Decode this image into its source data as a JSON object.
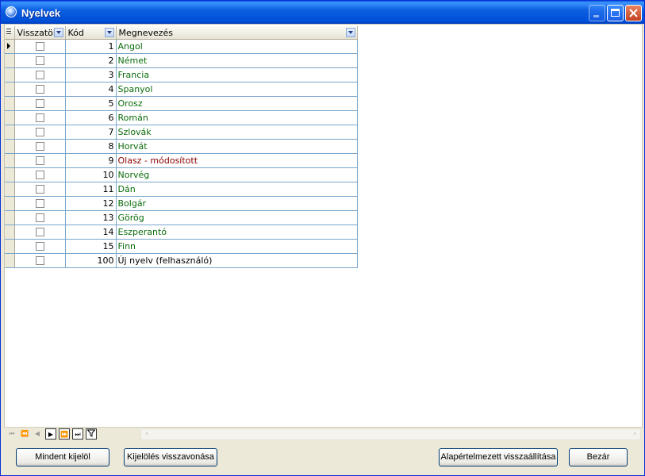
{
  "window": {
    "title": "Nyelvek"
  },
  "grid": {
    "columns": [
      {
        "label": "Visszatöl"
      },
      {
        "label": "Kód"
      },
      {
        "label": "Megnevezés"
      }
    ],
    "rows": [
      {
        "code": "1",
        "name": "Angol",
        "style": "normal"
      },
      {
        "code": "2",
        "name": "Német",
        "style": "normal"
      },
      {
        "code": "3",
        "name": "Francia",
        "style": "normal"
      },
      {
        "code": "4",
        "name": "Spanyol",
        "style": "normal"
      },
      {
        "code": "5",
        "name": "Orosz",
        "style": "normal"
      },
      {
        "code": "6",
        "name": "Román",
        "style": "normal"
      },
      {
        "code": "7",
        "name": "Szlovák",
        "style": "normal"
      },
      {
        "code": "8",
        "name": "Horvát",
        "style": "normal"
      },
      {
        "code": "9",
        "name": "Olasz - módosított",
        "style": "mod"
      },
      {
        "code": "10",
        "name": "Norvég",
        "style": "normal"
      },
      {
        "code": "11",
        "name": "Dán",
        "style": "normal"
      },
      {
        "code": "12",
        "name": "Bolgár",
        "style": "normal"
      },
      {
        "code": "13",
        "name": "Görög",
        "style": "normal"
      },
      {
        "code": "14",
        "name": "Eszperantó",
        "style": "normal"
      },
      {
        "code": "15",
        "name": "Finn",
        "style": "normal"
      },
      {
        "code": "100",
        "name": "Új nyelv (felhasználó)",
        "style": "black"
      }
    ]
  },
  "buttons": {
    "select_all": "Mindent kijelöl",
    "undo_selection": "Kijelölés visszavonása",
    "restore_default": "Alapértelmezett visszaállítása",
    "close": "Bezár"
  },
  "colors": {
    "name_normal": "#0b6c0b",
    "name_modified": "#8b0000",
    "grid_line": "#78a6cc"
  }
}
